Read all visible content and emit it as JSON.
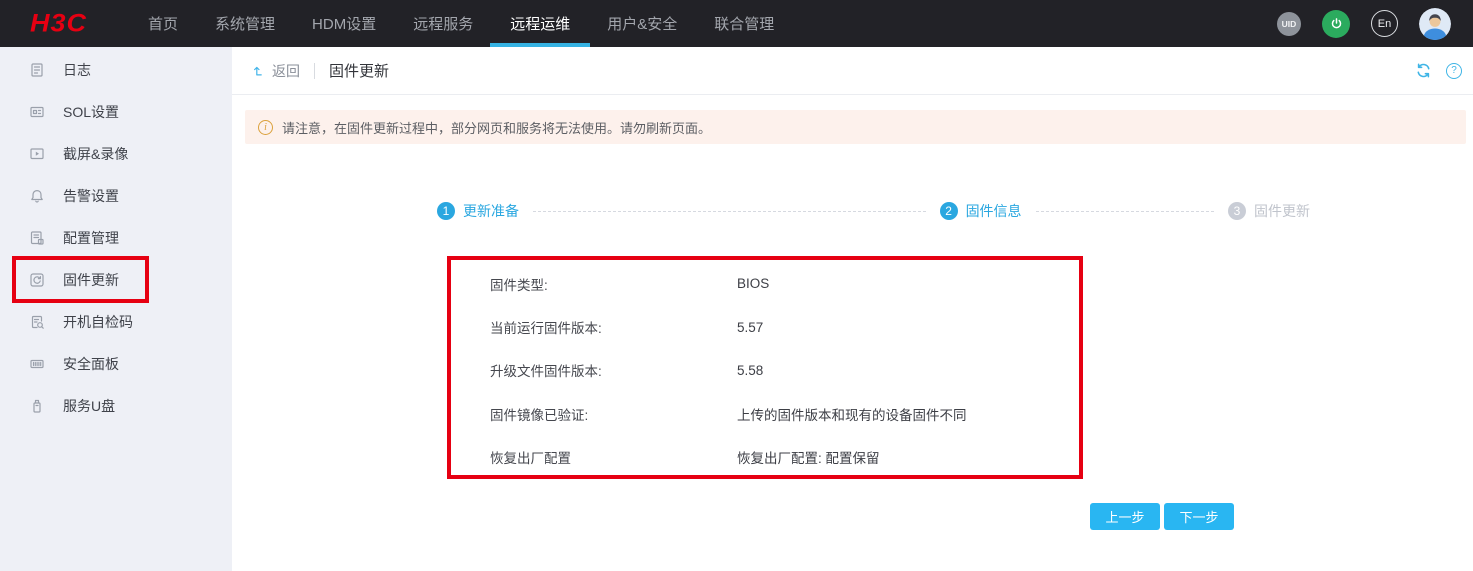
{
  "topbar": {
    "logo": "H3C",
    "nav": [
      {
        "label": "首页",
        "active": false
      },
      {
        "label": "系统管理",
        "active": false
      },
      {
        "label": "HDM设置",
        "active": false
      },
      {
        "label": "远程服务",
        "active": false
      },
      {
        "label": "远程运维",
        "active": true
      },
      {
        "label": "用户&安全",
        "active": false
      },
      {
        "label": "联合管理",
        "active": false
      }
    ],
    "badges": {
      "uid": "UID",
      "lang": "En"
    }
  },
  "sidebar": {
    "items": [
      {
        "icon": "log-icon",
        "label": "日志"
      },
      {
        "icon": "sol-icon",
        "label": "SOL设置"
      },
      {
        "icon": "screen-record-icon",
        "label": "截屏&录像"
      },
      {
        "icon": "alarm-icon",
        "label": "告警设置"
      },
      {
        "icon": "config-icon",
        "label": "配置管理"
      },
      {
        "icon": "firmware-icon",
        "label": "固件更新"
      },
      {
        "icon": "post-code-icon",
        "label": "开机自检码"
      },
      {
        "icon": "security-panel-icon",
        "label": "安全面板"
      },
      {
        "icon": "usb-icon",
        "label": "服务U盘"
      }
    ],
    "active_item": "固件更新"
  },
  "content": {
    "back_label": "返回",
    "page_title": "固件更新",
    "notice": "请注意，在固件更新过程中，部分网页和服务将无法使用。请勿刷新页面。",
    "steps": [
      {
        "num": "1",
        "label": "更新准备",
        "state": "active"
      },
      {
        "num": "2",
        "label": "固件信息",
        "state": "active"
      },
      {
        "num": "3",
        "label": "固件更新",
        "state": "pending"
      }
    ],
    "info_rows": [
      {
        "label": "固件类型:",
        "value": "BIOS"
      },
      {
        "label": "当前运行固件版本:",
        "value": "5.57"
      },
      {
        "label": "升级文件固件版本:",
        "value": "5.58"
      },
      {
        "label": "固件镜像已验证:",
        "value": "上传的固件版本和现有的设备固件不同"
      },
      {
        "label": "恢复出厂配置",
        "value": "恢复出厂配置: 配置保留"
      }
    ],
    "buttons": {
      "prev": "上一步",
      "next": "下一步"
    }
  },
  "icons": {
    "help_glyph": "?",
    "info_glyph": "i"
  },
  "colors": {
    "brand_red": "#e60012",
    "annotation_red": "#e60012",
    "accent_blue": "#2aa7e0",
    "button_blue": "#29b6f2",
    "nav_underline": "#35b2e2",
    "topbar_bg": "#222227",
    "sidebar_bg": "#eef0f6",
    "notice_bg": "#fdf1ec",
    "notice_icon": "#dba13c",
    "power_green": "#2bab5e"
  }
}
